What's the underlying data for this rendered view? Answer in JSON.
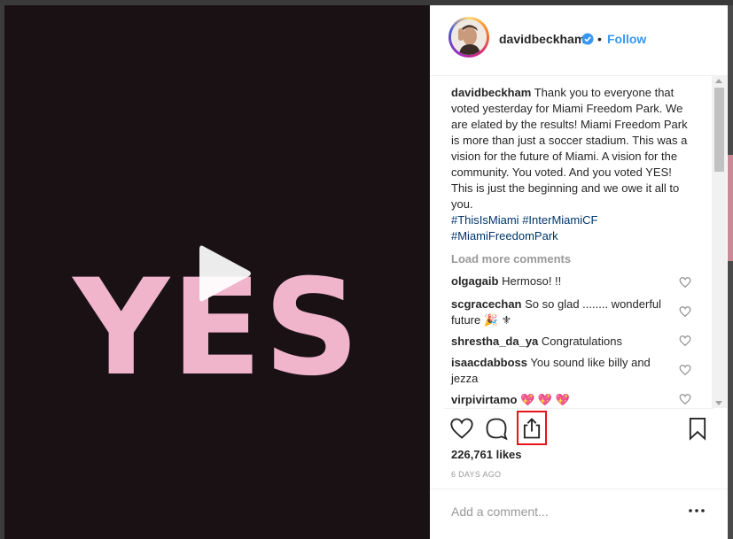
{
  "media": {
    "overlay_text": "YES"
  },
  "header": {
    "username": "davidbeckham",
    "separator": "•",
    "follow_label": "Follow"
  },
  "caption": {
    "username": "davidbeckham",
    "text": "Thank you to everyone that voted yesterday for Miami Freedom Park. We are elated by the results! Miami Freedom Park is more than just a soccer stadium. This was a vision for the future of Miami. A vision for the community. You voted. And you voted YES! This is just the beginning and we owe it all to you.",
    "hashtags": [
      "#ThisIsMiami",
      "#InterMiamiCF",
      "#MiamiFreedomPark"
    ]
  },
  "load_more_label": "Load more comments",
  "comments": [
    {
      "username": "olgagaib",
      "text": "Hermoso! !!"
    },
    {
      "username": "scgracechan",
      "text": "So so glad ........ wonderful future 🎉 ⚜"
    },
    {
      "username": "shrestha_da_ya",
      "text": "Congratulations"
    },
    {
      "username": "isaacdabboss",
      "text": "You sound like billy and jezza"
    },
    {
      "username": "virpivirtamo",
      "text": "💖 💖 💖"
    }
  ],
  "likes_label": "226,761 likes",
  "date_label": "6 DAYS AGO",
  "add_comment": {
    "placeholder": "Add a comment..."
  },
  "icons": {
    "play": "play-icon",
    "verified": "verified-badge-icon",
    "like": "heart-icon",
    "comment": "comment-bubble-icon",
    "share": "share-icon",
    "save": "bookmark-icon",
    "more": "more-options-icon"
  },
  "colors": {
    "accent": "#3897f0",
    "hashtag": "#003569",
    "yes_text": "#f0b4cb",
    "media_bg": "#1a1114",
    "highlight": "#e8141c"
  }
}
